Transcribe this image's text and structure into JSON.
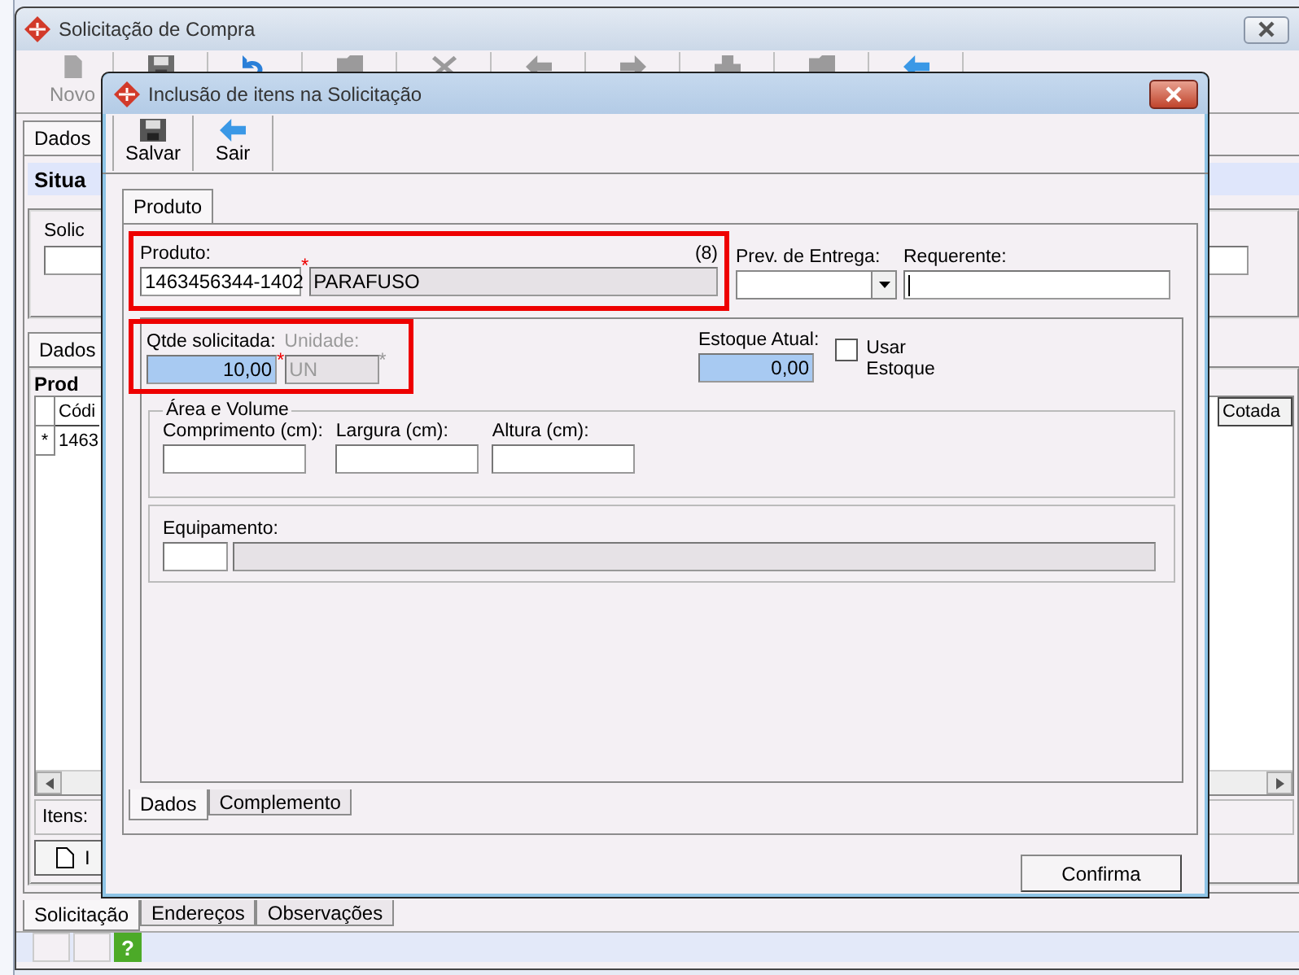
{
  "main_window": {
    "title": "Solicitação de Compra",
    "toolbar": [
      {
        "kind": "new",
        "label": "Novo",
        "disabled": true
      },
      {
        "kind": "save",
        "disabled": true
      },
      {
        "kind": "undo",
        "disabled": false
      },
      {
        "kind": "folder",
        "disabled": true
      },
      {
        "kind": "delete",
        "disabled": true
      },
      {
        "kind": "back",
        "disabled": true
      },
      {
        "kind": "forward",
        "disabled": true
      },
      {
        "kind": "print",
        "disabled": true
      },
      {
        "kind": "open",
        "disabled": true
      },
      {
        "kind": "exit",
        "disabled": false
      }
    ],
    "tabs": [
      {
        "label": "Dados",
        "selected": true
      }
    ],
    "section_title": "Situa",
    "field_label": "Solic",
    "inner_tab": "Dados",
    "group_title": "Prod",
    "grid": {
      "columns": [
        "Códi",
        "Cotada"
      ],
      "rows": [
        {
          "marker": "*",
          "cell": "1463"
        }
      ]
    },
    "items_label": "Itens:",
    "button_label": "I",
    "bottom_tabs": [
      {
        "label": "Solicitação",
        "selected": true
      },
      {
        "label": "Endereços",
        "selected": false
      },
      {
        "label": "Observações",
        "selected": false
      }
    ],
    "status_bar": {
      "help": "?"
    }
  },
  "dialog": {
    "title": "Inclusão de itens na Solicitação",
    "toolbar": [
      {
        "kind": "save",
        "label": "Salvar"
      },
      {
        "kind": "exit",
        "label": "Sair"
      }
    ],
    "tabs": [
      {
        "label": "Produto",
        "selected": true
      }
    ],
    "produto": {
      "label": "Produto:",
      "count": "(8)",
      "code": "1463456344-1402",
      "name": "PARAFUSO",
      "required_mark": "*"
    },
    "prev_entrega": {
      "label": "Prev. de Entrega:"
    },
    "requerente": {
      "label": "Requerente:"
    },
    "qtde": {
      "label": "Qtde solicitada:",
      "value": "10,00",
      "required_mark": "*"
    },
    "unidade": {
      "label": "Unidade:",
      "value": "UN",
      "disabled": true,
      "required_mark": "*"
    },
    "estoque": {
      "label": "Estoque Atual:",
      "value": "0,00"
    },
    "usar_estoque": {
      "label": "Usar Estoque",
      "checked": false
    },
    "area_volume": {
      "title": "Área e Volume",
      "fields": [
        {
          "label": "Comprimento (cm):"
        },
        {
          "label": "Largura (cm):"
        },
        {
          "label": "Altura (cm):"
        }
      ]
    },
    "equipamento": {
      "label": "Equipamento:"
    },
    "bottom_tabs": [
      {
        "label": "Dados",
        "selected": true
      },
      {
        "label": "Complemento",
        "selected": false
      }
    ],
    "confirm_button": "Confirma"
  }
}
